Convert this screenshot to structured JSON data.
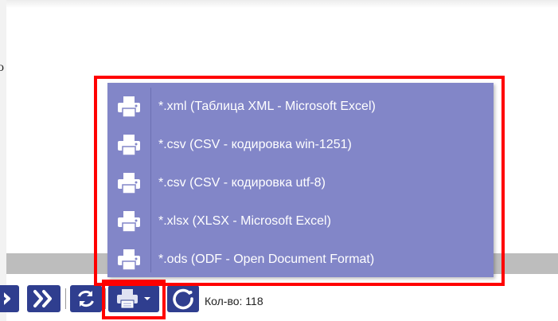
{
  "page": {
    "cut_glyph": "o"
  },
  "export_menu": {
    "items": [
      {
        "label": "*.xml (Таблица XML - Microsoft Excel)",
        "icon": "printer-icon"
      },
      {
        "label": "*.csv (CSV - кодировка win-1251)",
        "icon": "printer-icon"
      },
      {
        "label": "*.csv (CSV - кодировка utf-8)",
        "icon": "printer-icon"
      },
      {
        "label": "*.xlsx (XLSX - Microsoft Excel)",
        "icon": "printer-icon"
      },
      {
        "label": "*.ods (ODF - Open Document Format)",
        "icon": "printer-icon"
      }
    ]
  },
  "toolbar": {
    "count_label": "Кол-во: 118",
    "buttons": [
      {
        "name": "next-page",
        "icon": "chevron-right-icon"
      },
      {
        "name": "last-page",
        "icon": "double-chevron-right-icon"
      },
      {
        "name": "refresh",
        "icon": "refresh-icon"
      },
      {
        "name": "print-export",
        "icon": "printer-icon"
      },
      {
        "name": "loading",
        "icon": "spinner-icon"
      }
    ]
  },
  "colors": {
    "menu_bg": "#8286c8",
    "button_bg": "#2f3e8f",
    "highlight": "#ff0000",
    "grey_bar": "#bdbdbd"
  }
}
